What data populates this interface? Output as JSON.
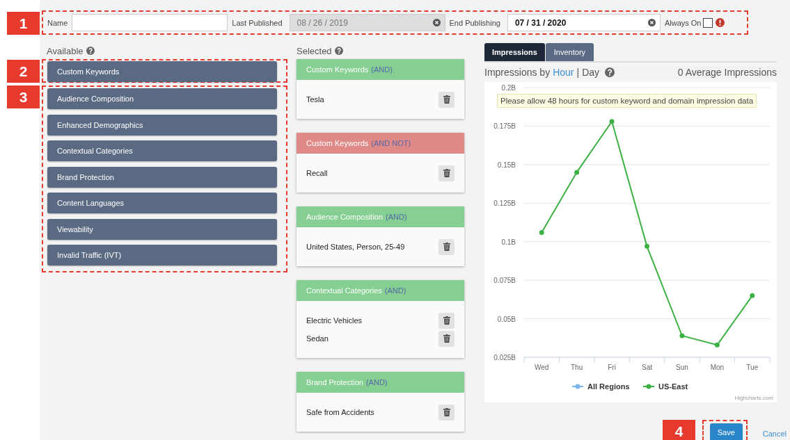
{
  "callouts": [
    "1",
    "2",
    "3",
    "4"
  ],
  "form": {
    "name_label": "Name",
    "last_published_label": "Last Published",
    "last_published_value": "08 / 26 / 2019",
    "last_published_disabled": true,
    "end_publishing_label": "End Publishing",
    "end_publishing_value": "07 / 31 / 2020",
    "always_on_label": "Always On",
    "always_on_checked": false
  },
  "available": {
    "title": "Available",
    "items": [
      "Custom Keywords",
      "Audience Composition",
      "Enhanced Demographics",
      "Contextual Categories",
      "Brand Protection",
      "Content Languages",
      "Viewability",
      "Invalid Traffic (IVT)"
    ]
  },
  "selected": {
    "title": "Selected",
    "groups": [
      {
        "title": "Custom Keywords",
        "operator": "(AND)",
        "kind": "include",
        "items": [
          "Tesla"
        ]
      },
      {
        "title": "Custom Keywords",
        "operator": "(AND NOT)",
        "kind": "exclude",
        "items": [
          "Recall"
        ]
      },
      {
        "title": "Audience Composition",
        "operator": "(AND)",
        "kind": "include",
        "items": [
          "United States, Person, 25-49"
        ]
      },
      {
        "title": "Contextual Categories",
        "operator": "(AND)",
        "kind": "include",
        "items": [
          "Electric Vehicles",
          "Sedan"
        ]
      },
      {
        "title": "Brand Protection",
        "operator": "(AND)",
        "kind": "include",
        "items": [
          "Safe from Accidents"
        ]
      }
    ]
  },
  "tabs": [
    {
      "label": "Impressions",
      "selected": true
    },
    {
      "label": "Inventory",
      "selected": false
    }
  ],
  "chart_header": {
    "title": "Impressions by",
    "options": [
      {
        "label": "Hour",
        "selected": false
      },
      {
        "label": "Day",
        "selected": true
      }
    ],
    "separator": "|",
    "average": "0 Average Impressions"
  },
  "notice": "Please allow 48 hours for custom keyword and domain impression data",
  "chart_data": {
    "type": "line",
    "categories": [
      "Wed",
      "Thu",
      "Fri",
      "Sat",
      "Sun",
      "Mon",
      "Tue"
    ],
    "series": [
      {
        "name": "All Regions",
        "color": "#7cb5ec",
        "marker": true,
        "values": [
          null,
          null,
          null,
          null,
          null,
          null,
          null
        ]
      },
      {
        "name": "US-East",
        "color": "#3cb043",
        "marker": true,
        "values": [
          0.106,
          0.145,
          0.178,
          0.097,
          0.039,
          0.033,
          0.065
        ]
      }
    ],
    "grid": true,
    "legend": "bottom",
    "ylim": [
      0.025,
      0.2
    ],
    "yticks": [
      {
        "value": 0.025,
        "label": "0.025B"
      },
      {
        "value": 0.05,
        "label": "0.05B"
      },
      {
        "value": 0.075,
        "label": "0.075B"
      },
      {
        "value": 0.1,
        "label": "0.1B"
      },
      {
        "value": 0.125,
        "label": "0.125B"
      },
      {
        "value": 0.15,
        "label": "0.15B"
      },
      {
        "value": 0.175,
        "label": "0.175B"
      },
      {
        "value": 0.2,
        "label": "0.2B"
      }
    ]
  },
  "credit": "Highcharts.com",
  "actions": {
    "save": "Save",
    "cancel": "Cancel"
  }
}
